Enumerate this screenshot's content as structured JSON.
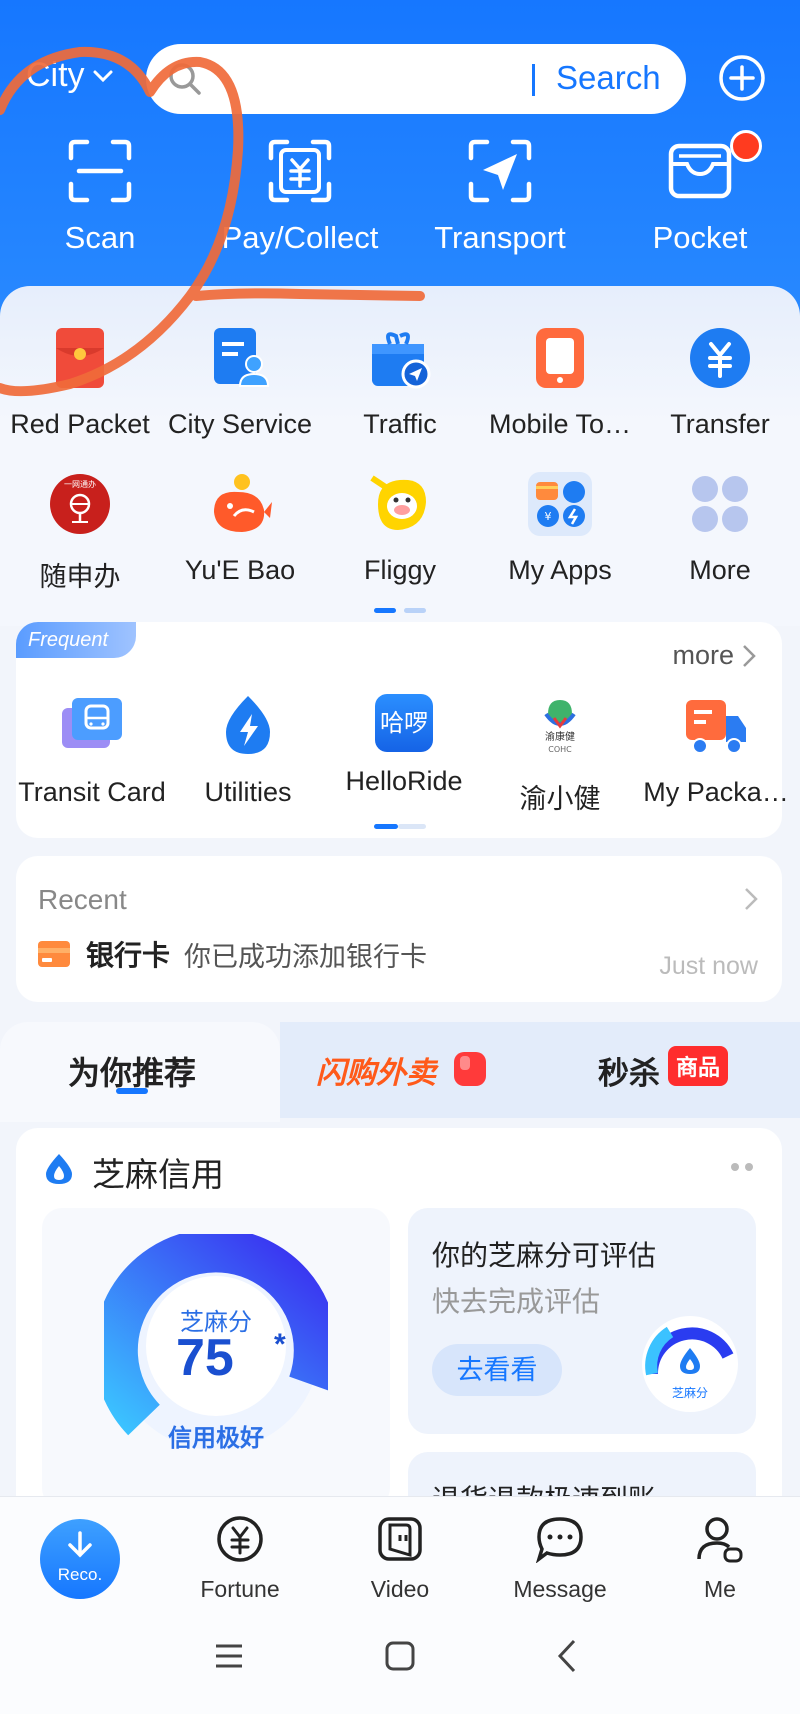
{
  "header": {
    "city_label": "City",
    "search_button": "Search"
  },
  "quick_actions": [
    {
      "label": "Scan",
      "icon": "scan-icon"
    },
    {
      "label": "Pay/Collect",
      "icon": "pay-collect-icon"
    },
    {
      "label": "Transport",
      "icon": "transport-icon"
    },
    {
      "label": "Pocket",
      "icon": "pocket-icon",
      "has_dot": true
    }
  ],
  "apps_row1": [
    {
      "label": "Red Packet",
      "icon": "red-packet-icon"
    },
    {
      "label": "City Service",
      "icon": "city-service-icon"
    },
    {
      "label": "Traffic",
      "icon": "traffic-icon"
    },
    {
      "label": "Mobile To…",
      "icon": "mobile-topup-icon"
    },
    {
      "label": "Transfer",
      "icon": "transfer-icon"
    }
  ],
  "apps_row2": [
    {
      "label": "随申办",
      "icon": "suishenban-icon"
    },
    {
      "label": "Yu'E Bao",
      "icon": "yuebao-icon"
    },
    {
      "label": "Fliggy",
      "icon": "fliggy-icon"
    },
    {
      "label": "My Apps",
      "icon": "my-apps-icon"
    },
    {
      "label": "More",
      "icon": "more-apps-icon"
    }
  ],
  "frequent": {
    "tag": "Frequent",
    "more_label": "more",
    "items": [
      {
        "label": "Transit Card",
        "icon": "transit-card-icon"
      },
      {
        "label": "Utilities",
        "icon": "utilities-icon"
      },
      {
        "label": "HelloRide",
        "icon": "helloride-icon",
        "icon_text": "哈啰"
      },
      {
        "label": "渝小健",
        "icon": "yuxiaojian-icon",
        "icon_text": "渝康健\nCOHC"
      },
      {
        "label": "My Packa…",
        "icon": "my-package-icon"
      }
    ]
  },
  "recent": {
    "label": "Recent",
    "bank_label": "银行卡",
    "message": "你已成功添加银行卡",
    "time": "Just now"
  },
  "feed_tabs": {
    "tab1": "为你推荐",
    "tab2": "闪购外卖",
    "tab3": "秒杀",
    "tab3_badge": "商品"
  },
  "sesame": {
    "title": "芝麻信用",
    "gauge_label": "芝麻分",
    "score": "75",
    "score_mark": "*",
    "rating": "信用极好",
    "estimate_title": "你的芝麻分可评估",
    "estimate_sub": "快去完成评估",
    "estimate_button": "去看看",
    "mini_label": "芝麻分",
    "refund_text": "退货退款极速到账"
  },
  "tabbar": {
    "reco": "Reco.",
    "fortune": "Fortune",
    "video": "Video",
    "message": "Message",
    "me": "Me"
  },
  "colors": {
    "brand_blue": "#1677ff",
    "hero_bg": "#2a8bff",
    "annotation_orange": "#f06a3a",
    "badge_red": "#ff2d2d"
  }
}
